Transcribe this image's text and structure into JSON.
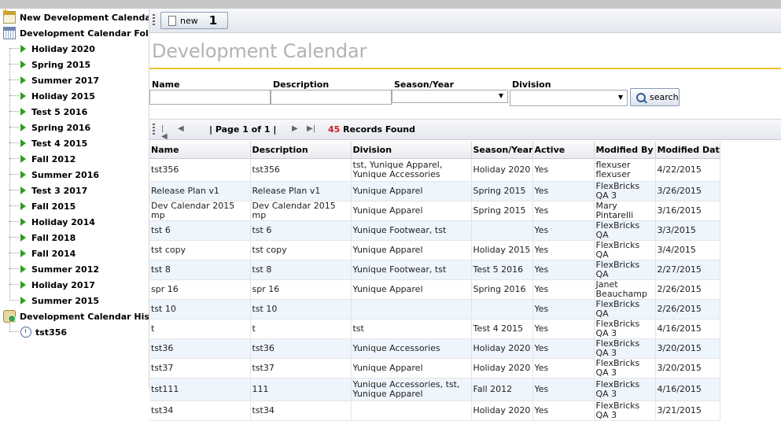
{
  "sidebar": {
    "new_calendar": "New Development Calendar",
    "folder_label": "Development Calendar Folder",
    "items": [
      "Holiday 2020",
      "Spring 2015",
      "Summer 2017",
      "Holiday 2015",
      "Test 5 2016",
      "Spring 2016",
      "Test 4 2015",
      "Fall 2012",
      "Summer 2016",
      "Test 3 2017",
      "Fall 2015",
      "Holiday 2014",
      "Fall 2018",
      "Fall 2014",
      "Summer 2012",
      "Holiday 2017",
      "Summer 2015"
    ],
    "history_label": "Development Calendar History",
    "history_items": [
      "tst356"
    ]
  },
  "toolbar": {
    "new_label": "new",
    "new_badge": "1"
  },
  "page_title": "Development Calendar",
  "filters": {
    "name_label": "Name",
    "description_label": "Description",
    "season_label": "Season/Year",
    "division_label": "Division",
    "search_label": "search"
  },
  "pager": {
    "page_text": "| Page 1 of 1 |",
    "count": "45",
    "count_suffix": "Records Found"
  },
  "table": {
    "columns": [
      "Name",
      "Description",
      "Division",
      "Season/Year",
      "Active",
      "Modified By",
      "Modified Date"
    ],
    "rows": [
      [
        "tst356",
        "tst356",
        "tst, Yunique Apparel, Yunique Accessories",
        "Holiday 2020",
        "Yes",
        "flexuser flexuser",
        "4/22/2015"
      ],
      [
        "Release Plan v1",
        "Release Plan v1",
        "Yunique Apparel",
        "Spring 2015",
        "Yes",
        "FlexBricks QA 3",
        "3/26/2015"
      ],
      [
        "Dev Calendar 2015 mp",
        "Dev Calendar 2015 mp",
        "Yunique Apparel",
        "Spring 2015",
        "Yes",
        "Mary Pintarelli",
        "3/16/2015"
      ],
      [
        "tst 6",
        "tst 6",
        "Yunique Footwear, tst",
        "",
        "Yes",
        "FlexBricks QA",
        "3/3/2015"
      ],
      [
        "tst copy",
        "tst copy",
        "Yunique Apparel",
        "Holiday 2015",
        "Yes",
        "FlexBricks QA",
        "3/4/2015"
      ],
      [
        "tst 8",
        "tst 8",
        "Yunique Footwear, tst",
        "Test 5 2016",
        "Yes",
        "FlexBricks QA",
        "2/27/2015"
      ],
      [
        "spr 16",
        "spr 16",
        "Yunique Apparel",
        "Spring 2016",
        "Yes",
        "Janet Beauchamp",
        "2/26/2015"
      ],
      [
        "tst 10",
        "tst 10",
        "",
        "",
        "Yes",
        "FlexBricks QA",
        "2/26/2015"
      ],
      [
        "t",
        "t",
        "tst",
        "Test 4 2015",
        "Yes",
        "FlexBricks QA 3",
        "4/16/2015"
      ],
      [
        "tst36",
        "tst36",
        "Yunique Accessories",
        "Holiday 2020",
        "Yes",
        "FlexBricks QA 3",
        "3/20/2015"
      ],
      [
        "tst37",
        "tst37",
        "Yunique Apparel",
        "Holiday 2020",
        "Yes",
        "FlexBricks QA 3",
        "3/20/2015"
      ],
      [
        "tst111",
        "111",
        "Yunique Accessories, tst, Yunique Apparel",
        "Fall 2012",
        "Yes",
        "FlexBricks QA 3",
        "4/16/2015"
      ],
      [
        "tst34",
        "tst34",
        "",
        "Holiday 2020",
        "Yes",
        "FlexBricks QA 3",
        "3/21/2015"
      ]
    ]
  }
}
